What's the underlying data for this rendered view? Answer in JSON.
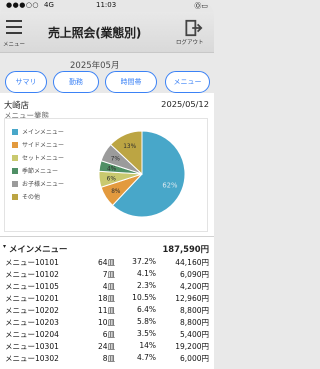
{
  "status_bar": {
    "signal": "●●●○○",
    "carrier": "4G",
    "time": "11:03",
    "right": "Ⓞ▭"
  },
  "header": {
    "menu_label": "メニュー",
    "title": "売上照会(業態別)",
    "logout_label": "ログアウト"
  },
  "tabs": [
    {
      "label": "サマリ"
    },
    {
      "label": "勤務"
    },
    {
      "label": "時間帯"
    },
    {
      "label": "メニュー"
    }
  ],
  "date_overlay": "2025年05月",
  "store": {
    "name": "大崎店",
    "date": "2025/05/12"
  },
  "chart": {
    "title_overlay": "メニュー業態",
    "legend": [
      {
        "label": "メインメニュー",
        "color": "#48a7c9"
      },
      {
        "label": "サイドメニュー",
        "color": "#e39a3e"
      },
      {
        "label": "セットメニュー",
        "color": "#c9c96f"
      },
      {
        "label": "季節メニュー",
        "color": "#4f8f65"
      },
      {
        "label": "お子様メニュー",
        "color": "#9b9b9b"
      },
      {
        "label": "その他",
        "color": "#bca543"
      }
    ]
  },
  "chart_data": {
    "type": "pie",
    "title": "",
    "categories": [
      "メインメニュー",
      "サイドメニュー",
      "セットメニュー",
      "季節メニュー",
      "お子様メニュー",
      "その他"
    ],
    "values": [
      62,
      8,
      6,
      4,
      7,
      13
    ],
    "labels": [
      "62%",
      "8%",
      "6%",
      "4%",
      "7%",
      "13%"
    ]
  },
  "group": {
    "label": "メインメニュー",
    "total": "187,590円"
  },
  "rows": [
    {
      "name": "メニュー10101",
      "qty": "64皿",
      "pct": "37.2%",
      "amount": "44,160円"
    },
    {
      "name": "メニュー10102",
      "qty": "7皿",
      "pct": "4.1%",
      "amount": "6,090円"
    },
    {
      "name": "メニュー10105",
      "qty": "4皿",
      "pct": "2.3%",
      "amount": "4,200円"
    },
    {
      "name": "メニュー10201",
      "qty": "18皿",
      "pct": "10.5%",
      "amount": "12,960円"
    },
    {
      "name": "メニュー10202",
      "qty": "11皿",
      "pct": "6.4%",
      "amount": "8,800円"
    },
    {
      "name": "メニュー10203",
      "qty": "10皿",
      "pct": "5.8%",
      "amount": "8,800円"
    },
    {
      "name": "メニュー10204",
      "qty": "6皿",
      "pct": "3.5%",
      "amount": "5,400円"
    },
    {
      "name": "メニュー10301",
      "qty": "24皿",
      "pct": "14%",
      "amount": "19,200円"
    },
    {
      "name": "メニュー10302",
      "qty": "8皿",
      "pct": "4.7%",
      "amount": "6,000円"
    }
  ]
}
